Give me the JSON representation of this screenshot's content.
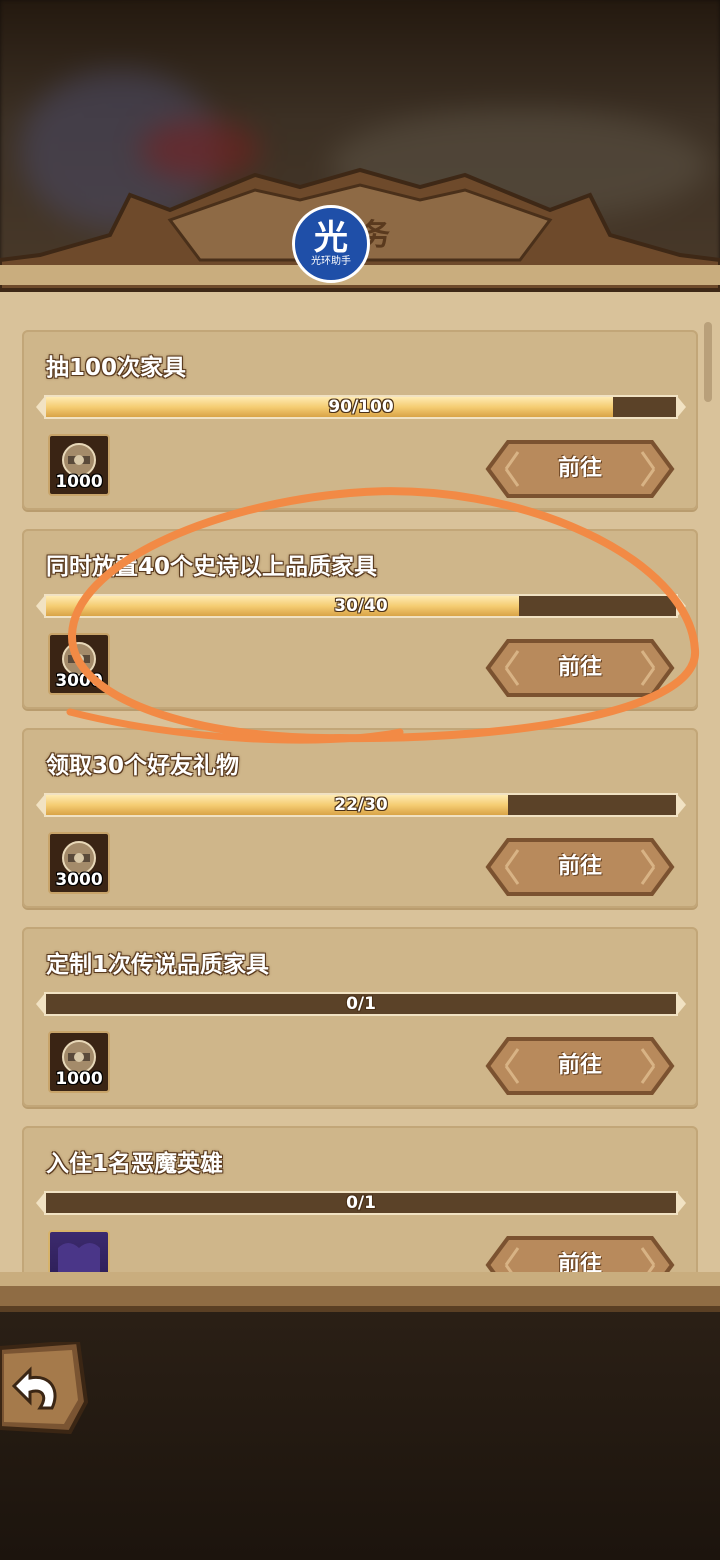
{
  "header": {
    "title": "任务"
  },
  "watermark": {
    "big": "光",
    "small": "光环助手"
  },
  "tasks": [
    {
      "title": "抽100次家具",
      "progress_text": "90/100",
      "progress": 0.9,
      "reward_qty": "1000",
      "reward_type": "gear-coin-icon",
      "button": "前往"
    },
    {
      "title": "同时放置40个史诗以上品质家具",
      "progress_text": "30/40",
      "progress": 0.75,
      "reward_qty": "3000",
      "reward_type": "gear-coin-icon",
      "button": "前往"
    },
    {
      "title": "领取30个好友礼物",
      "progress_text": "22/30",
      "progress": 0.733,
      "reward_qty": "3000",
      "reward_type": "gear-coin-icon",
      "button": "前往"
    },
    {
      "title": "定制1次传说品质家具",
      "progress_text": "0/1",
      "progress": 0,
      "reward_qty": "1000",
      "reward_type": "gear-coin-icon",
      "button": "前往"
    },
    {
      "title": "入住1名恶魔英雄",
      "progress_text": "0/1",
      "progress": 0,
      "reward_qty": "",
      "reward_type": "hero-card-icon",
      "button": "前往"
    }
  ],
  "colors": {
    "panel": "#d9c29a",
    "card": "#cfb68a",
    "bar_fill": "#f5cd73",
    "annotation": "#f28a45"
  }
}
